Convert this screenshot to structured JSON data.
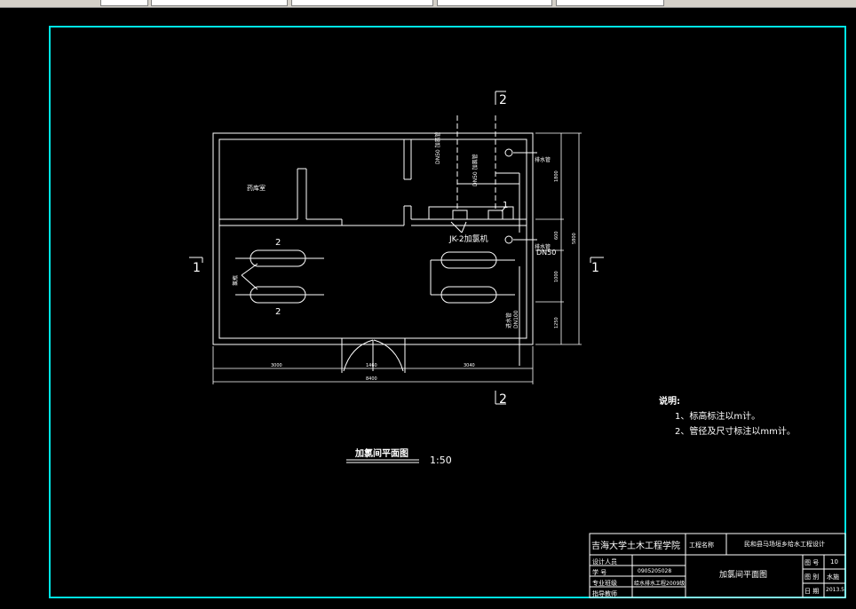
{
  "drawing": {
    "title": "加氯间平面图",
    "scale": "1:50",
    "section_markers": {
      "vertical": "2",
      "horizontal": "1"
    },
    "rooms": {
      "storage": "药库室"
    },
    "labels": {
      "equipment_number": "2",
      "chlorinator_number": "1",
      "chlorinator": "JK-2加氯机",
      "pipe_dn50": "DN50",
      "pipe_dn50_a": "DN50 加氯管",
      "pipe_dn50_b": "DN50 加氯管",
      "drain_pipe_1": "排水管",
      "drain_pipe_2": "排水管",
      "water_inlet": "进水管",
      "pipe_dn100": "DN100",
      "cylinders": "氯瓶"
    },
    "dimensions": {
      "bottom_left": "3000",
      "bottom_mid": "1460",
      "bottom_right": "3040",
      "bottom_total": "8400",
      "right_1": "1800",
      "right_2": "600",
      "right_3": "1000",
      "right_4": "1250",
      "right_total": "5800"
    }
  },
  "notes": {
    "title": "说明:",
    "items": [
      "1、标高标注以m计。",
      "2、管径及尺寸标注以mm计。"
    ]
  },
  "title_block": {
    "school": "吉海大学土木工程学院",
    "project_label": "工程名称",
    "project_name": "民和县马场垣乡给水工程设计",
    "designer_label": "设计人员",
    "student_id_label": "学    号",
    "student_id": "0905205028",
    "class_label": "专业班级",
    "class_name": "给水排水工程2009级",
    "advisor_label": "指导教师",
    "drawing_name": "加氯间平面图",
    "fig_no_label": "图 号",
    "fig_no": "10",
    "fig_type_label": "图 别",
    "fig_type": "水施",
    "date_label": "日 期",
    "date": "2013.5"
  }
}
